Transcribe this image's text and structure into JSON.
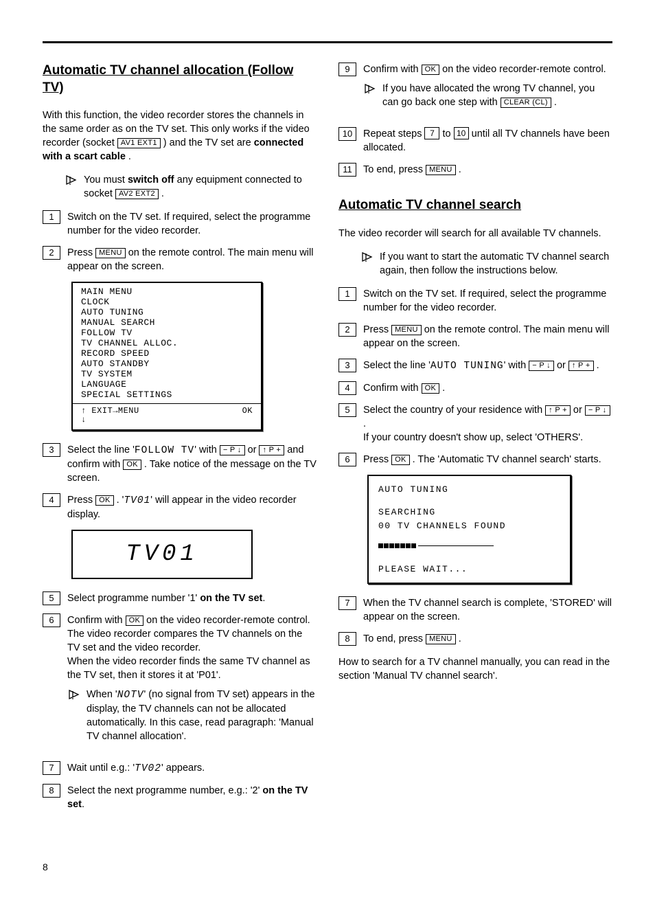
{
  "page_number": "8",
  "left": {
    "heading": "Automatic TV channel allocation (Follow TV)",
    "intro_a": "With this function, the video recorder stores the channels in the same order as on the TV set. This only works if the video recorder (socket ",
    "intro_socket1": "AV1 EXT1",
    "intro_b": " ) and the TV set are ",
    "intro_bold": "connected with a scart cable",
    "intro_c": ".",
    "tip1_a": "You must ",
    "tip1_bold": "switch off",
    "tip1_b": " any equipment connected to socket ",
    "tip1_socket": "AV2 EXT2",
    "tip1_c": " .",
    "step1": "Switch on the TV set. If required, select the programme number for the video recorder.",
    "step2_a": "Press ",
    "step2_btn": "MENU",
    "step2_b": " on the remote control. The main menu will appear on the screen.",
    "osd": {
      "line1": "MAIN MENU",
      "line2": "CLOCK",
      "line3": "AUTO TUNING",
      "line4": "MANUAL SEARCH",
      "line5": "FOLLOW TV",
      "line6": "TV CHANNEL ALLOC.",
      "line7": "RECORD SPEED",
      "line8": "AUTO STANDBY",
      "line9": "TV SYSTEM",
      "line10": "LANGUAGE",
      "line11": "SPECIAL SETTINGS",
      "stat_left": "↑ EXIT→MENU",
      "stat_right": "OK",
      "stat_down": "↓"
    },
    "step3_a": "Select the line '",
    "step3_follow": "FOLLOW TV",
    "step3_b": "' with ",
    "step3_btn1": "− P ↓",
    "step3_or": " or ",
    "step3_btn2": "↑ P +",
    "step3_c": " and confirm with ",
    "step3_ok": "OK",
    "step3_d": " . Take notice of the message on the TV screen.",
    "step4_a": "Press ",
    "step4_ok": "OK",
    "step4_b": " . '",
    "step4_seg": "TV01",
    "step4_c": "' will appear in the video recorder display.",
    "segbox": "TV01",
    "step5_a": "Select programme number '1' ",
    "step5_bold": "on the TV set",
    "step5_b": ".",
    "step6_a": "Confirm with ",
    "step6_ok": "OK",
    "step6_b": " on the video recorder-remote control. The video recorder compares the TV channels on the TV set and the video recorder.",
    "step6_c": "When the video recorder finds the same TV channel as the TV set, then it stores it at 'P01'.",
    "tip6_a": "When '",
    "tip6_seg": "NOTV",
    "tip6_b": "' (no signal from TV set) appears in the display, the TV channels can not be allocated automatically. In this case, read paragraph: 'Manual TV channel allocation'.",
    "step7_a": "Wait until e.g.: '",
    "step7_seg": "TV02",
    "step7_b": "' appears.",
    "step8_a": "Select the next programme number, e.g.: '2' ",
    "step8_bold": "on the TV set",
    "step8_b": "."
  },
  "right": {
    "step9_a": "Confirm with ",
    "step9_ok": "OK",
    "step9_b": " on the video recorder-remote control.",
    "tip9_a": "If you have allocated the wrong TV channel, you can go back one step with ",
    "tip9_btn": "CLEAR (CL)",
    "tip9_b": " .",
    "step10_a": "Repeat steps ",
    "step10_from": "7",
    "step10_to_word": " to ",
    "step10_to": "10",
    "step10_b": " until  all TV channels have been allocated.",
    "step11_a": "To end, press ",
    "step11_btn": "MENU",
    "step11_b": " .",
    "heading2": "Automatic TV channel search",
    "intro2": "The video recorder will search for all available TV channels.",
    "tip2": "If you want to start the automatic TV channel search again, then follow the instructions below.",
    "s1": "Switch on the TV set. If required, select the programme number for the video recorder.",
    "s2_a": "Press ",
    "s2_btn": "MENU",
    "s2_b": " on the remote control. The main menu will appear on the screen.",
    "s3_a": "Select the line '",
    "s3_mono": "AUTO TUNING",
    "s3_b": "' with ",
    "s3_btn1": "− P ↓",
    "s3_or": " or ",
    "s3_btn2": "↑ P +",
    "s3_c": " .",
    "s4_a": "Confirm with ",
    "s4_ok": "OK",
    "s4_b": " .",
    "s5_a": "Select the country of your residence with ",
    "s5_btn1": "↑ P +",
    "s5_or": " or ",
    "s5_btn2": "− P ↓",
    "s5_b": " .",
    "s5_c": "If your country doesn't show up, select 'OTHERS'.",
    "s6_a": "Press ",
    "s6_ok": "OK",
    "s6_b": " . The 'Automatic TV channel search' starts.",
    "osd2": {
      "line1": "AUTO TUNING",
      "line2": "SEARCHING",
      "line3": "00 TV CHANNELS FOUND",
      "line4": "PLEASE WAIT..."
    },
    "s7": "When the TV channel search is complete, 'STORED' will appear on the screen.",
    "s8_a": "To end, press ",
    "s8_btn": "MENU",
    "s8_b": " .",
    "outro": "How to search for a TV channel manually, you can read in the section 'Manual TV channel search'."
  }
}
